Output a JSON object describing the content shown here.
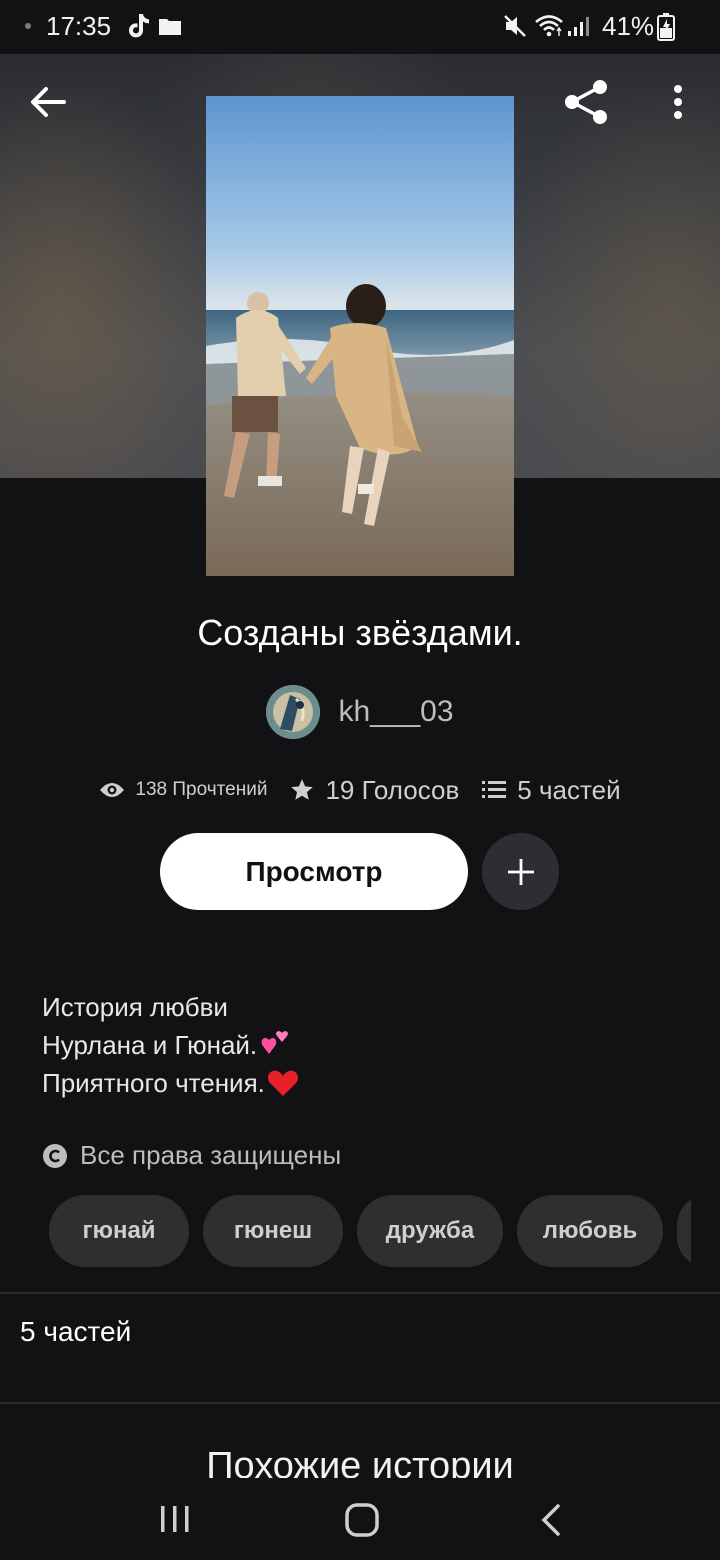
{
  "status_bar": {
    "time": "17:35",
    "battery": "41%",
    "icons": [
      "tiktok-icon",
      "folder-icon",
      "mute-icon",
      "wifi-icon",
      "signal-icon",
      "battery-icon"
    ]
  },
  "header": {
    "back_icon": "arrow-left-icon",
    "share_icon": "share-icon",
    "more_icon": "more-vertical-icon"
  },
  "story": {
    "title": "Созданы звёздами.",
    "author": "kh___03",
    "stats": {
      "reads": "138 Прочтений",
      "votes": "19 Голосов",
      "parts": "5 частей"
    },
    "read_button": "Просмотр",
    "description": [
      {
        "text": "История любви",
        "emoji": ""
      },
      {
        "text": "Нурлана и Гюнай.",
        "emoji": "two-hearts-icon"
      },
      {
        "text": "Приятного чтения.",
        "emoji": "red-heart-icon"
      }
    ],
    "copyright": "Все права защищены",
    "tags": [
      "гюнай",
      "гюнеш",
      "дружба",
      "любовь",
      ""
    ]
  },
  "sections": {
    "parts_heading": "5 частей",
    "similar_heading": "Похожие истории"
  },
  "colors": {
    "background": "#121114",
    "chip": "#2f2e31",
    "button_primary": "#ffffff"
  }
}
